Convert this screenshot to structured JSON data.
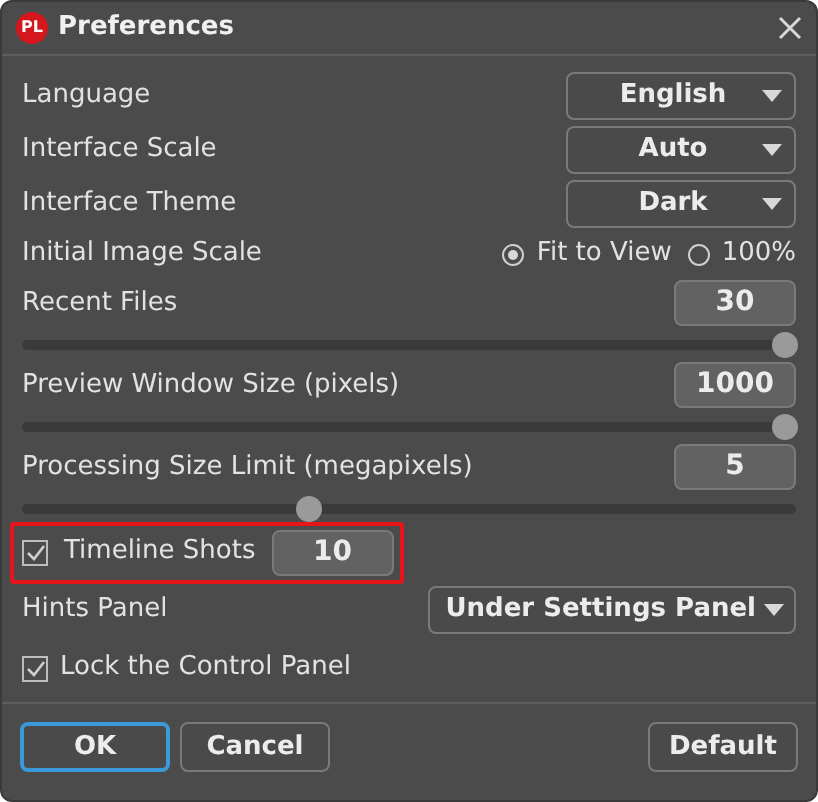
{
  "window": {
    "title": "Preferences",
    "logo": "PL"
  },
  "settings": [
    {
      "kind": "dropdown",
      "label": "Language",
      "value": "English"
    },
    {
      "kind": "dropdown",
      "label": "Interface Scale",
      "value": "Auto"
    },
    {
      "kind": "dropdown",
      "label": "Interface Theme",
      "value": "Dark"
    },
    {
      "kind": "radio",
      "label": "Initial Image Scale",
      "options": [
        {
          "label": "Fit to View",
          "selected": true
        },
        {
          "label": "100%",
          "selected": false
        }
      ]
    },
    {
      "kind": "slider",
      "label": "Recent Files",
      "value": "30",
      "level": 0.985
    },
    {
      "kind": "slider",
      "label": "Preview Window Size (pixels)",
      "value": "1000",
      "level": 0.985
    },
    {
      "kind": "slider",
      "label": "Processing Size Limit (megapixels)",
      "value": "5",
      "level": 0.37
    },
    {
      "kind": "checkbox-number",
      "label": "Timeline Shots",
      "value": "10",
      "checked": true,
      "highlighted": true
    },
    {
      "kind": "wide-dropdown",
      "label": "Hints Panel",
      "value": "Under Settings Panel"
    },
    {
      "kind": "checkbox",
      "label": "Lock the Control Panel",
      "checked": true
    }
  ],
  "buttons": [
    {
      "label": "OK",
      "focused": true
    },
    {
      "label": "Cancel",
      "focused": false
    },
    {
      "label": "Default",
      "focused": false
    }
  ]
}
